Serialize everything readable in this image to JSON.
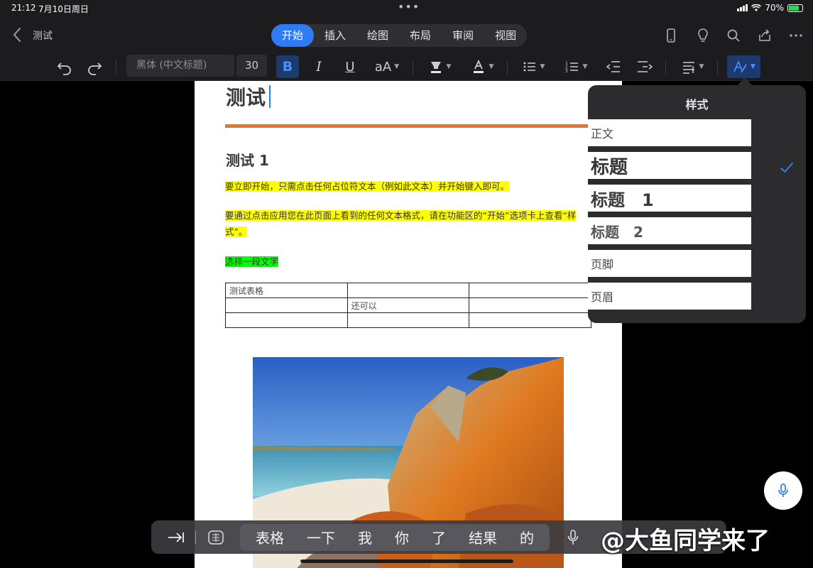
{
  "status": {
    "time": "21:12",
    "date": "7月10日周日",
    "battery": "70%"
  },
  "nav": {
    "title": "测试",
    "tabs": [
      {
        "label": "开始",
        "active": true
      },
      {
        "label": "插入",
        "active": false
      },
      {
        "label": "绘图",
        "active": false
      },
      {
        "label": "布局",
        "active": false
      },
      {
        "label": "审阅",
        "active": false
      },
      {
        "label": "视图",
        "active": false
      }
    ],
    "right_icons": [
      "phone-icon",
      "lightbulb-icon",
      "search-icon",
      "share-icon",
      "more-icon"
    ]
  },
  "toolbar": {
    "font_name": "黑体 (中文标题)",
    "font_size": "30",
    "bold": "B",
    "italic": "I",
    "underline": "U",
    "text_size": "aA"
  },
  "document": {
    "title": "测试",
    "heading1": "测试 1",
    "para1": "要立即开始，只需点击任何占位符文本（例如此文本）并开始键入即可。",
    "para2_line1": "要通过点击应用您在此页面上看到的任何文本格式，请在功能区的“开始”选项卡上查看“样",
    "para2_line2": "式”。",
    "para3": "选择一段文字",
    "table": [
      [
        "测试表格",
        "",
        ""
      ],
      [
        "",
        "还可以",
        ""
      ],
      [
        "",
        "",
        ""
      ]
    ]
  },
  "styles_panel": {
    "title": "样式",
    "options": [
      {
        "label": "正文",
        "selected": false
      },
      {
        "label": "标题",
        "selected": true
      },
      {
        "label": "标题　1",
        "selected": false
      },
      {
        "label": "标题　2",
        "selected": false
      },
      {
        "label": "页脚",
        "selected": false
      },
      {
        "label": "页眉",
        "selected": false
      }
    ]
  },
  "keyboard": {
    "candidates": [
      "表格",
      "一下",
      "我",
      "你",
      "了",
      "结果",
      "的"
    ]
  },
  "watermark": "@大鱼同学来了",
  "colors": {
    "accent": "#2f7bf6",
    "rule": "#e8742a",
    "highlight_yellow": "#ffff00",
    "highlight_green": "#00ff00"
  }
}
